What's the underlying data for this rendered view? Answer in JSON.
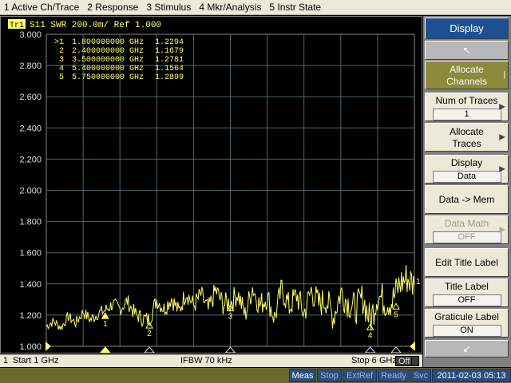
{
  "menu": {
    "items": [
      "1 Active Ch/Trace",
      "2 Response",
      "3 Stimulus",
      "4 Mkr/Analysis",
      "5 Instr State"
    ]
  },
  "trace": {
    "badge": "Tr1",
    "header": "S11  SWR 200.0m/ Ref 1.000",
    "color": "#ffff66"
  },
  "markers": [
    {
      "id": ">1",
      "freq": "1.800000000 GHz",
      "value": "1.2294",
      "label": "1"
    },
    {
      "id": "2",
      "freq": "2.400000000 GHz",
      "value": "1.1679",
      "label": "2"
    },
    {
      "id": "3",
      "freq": "3.500000000 GHz",
      "value": "1.2781",
      "label": "3"
    },
    {
      "id": "4",
      "freq": "5.400000000 GHz",
      "value": "1.1564",
      "label": "4"
    },
    {
      "id": "5",
      "freq": "5.750000000 GHz",
      "value": "1.2899",
      "label": "5"
    }
  ],
  "chart_data": {
    "type": "line",
    "y_ticks": [
      "3.000",
      "2.800",
      "2.600",
      "2.400",
      "2.200",
      "2.000",
      "1.800",
      "1.600",
      "1.400",
      "1.200",
      "1.000"
    ],
    "ylim": [
      1.0,
      3.0
    ],
    "xlim_ghz": [
      1.0,
      6.0
    ],
    "grid": true,
    "series": [
      {
        "x_ghz": [
          1.0,
          1.1,
          1.2,
          1.3,
          1.4,
          1.5,
          1.6,
          1.7,
          1.8,
          1.9,
          2.0,
          2.1,
          2.2,
          2.3,
          2.4,
          2.5,
          2.6,
          2.7,
          2.8,
          2.9,
          3.0,
          3.1,
          3.2,
          3.3,
          3.4,
          3.5,
          3.6,
          3.7,
          3.8,
          3.9,
          4.0,
          4.1,
          4.2,
          4.3,
          4.4,
          4.5,
          4.6,
          4.7,
          4.8,
          4.9,
          5.0,
          5.1,
          5.2,
          5.3,
          5.4,
          5.5,
          5.6,
          5.7,
          5.8,
          5.9,
          6.0
        ],
        "values": [
          1.13,
          1.16,
          1.12,
          1.19,
          1.15,
          1.22,
          1.17,
          1.21,
          1.23,
          1.27,
          1.24,
          1.29,
          1.21,
          1.18,
          1.17,
          1.3,
          1.24,
          1.31,
          1.22,
          1.35,
          1.26,
          1.33,
          1.23,
          1.36,
          1.27,
          1.28,
          1.34,
          1.2,
          1.38,
          1.26,
          1.32,
          1.18,
          1.37,
          1.25,
          1.33,
          1.21,
          1.36,
          1.27,
          1.3,
          1.19,
          1.35,
          1.28,
          1.24,
          1.31,
          1.16,
          1.33,
          1.29,
          1.29,
          1.4,
          1.44,
          1.39
        ]
      }
    ]
  },
  "softkeys": {
    "title": "Display",
    "allocate_channels": "Allocate Channels",
    "num_traces_label": "Num of Traces",
    "num_traces_value": "1",
    "allocate_traces": "Allocate Traces",
    "display_label": "Display",
    "display_value": "Data",
    "data_mem": "Data -> Mem",
    "data_math_label": "Data Math",
    "data_math_value": "OFF",
    "edit_title": "Edit Title Label",
    "title_label": "Title Label",
    "title_label_value": "OFF",
    "graticule_label": "Graticule Label",
    "graticule_value": "ON"
  },
  "statusline": {
    "channel": "1",
    "start": "Start 1 GHz",
    "ifbw": "IFBW 70 kHz",
    "stop": "Stop 6 GHz",
    "off_badge": "Off"
  },
  "bottombar": {
    "meas": "Meas",
    "stop": "Stop",
    "extref": "ExtRef",
    "ready": "Ready",
    "svc": "Svc",
    "datetime": "2011-02-03 05:13"
  }
}
